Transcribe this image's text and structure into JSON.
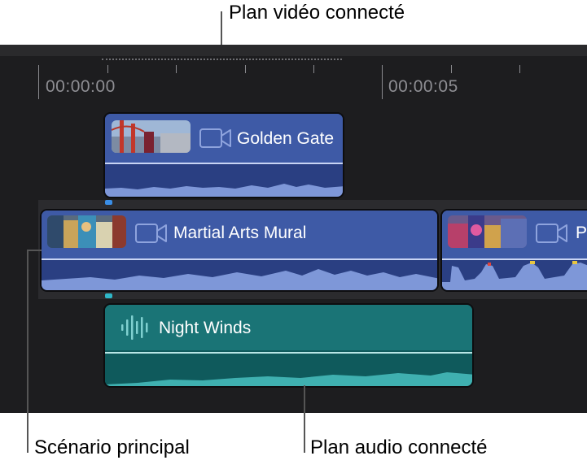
{
  "callouts": {
    "connected_video": "Plan vidéo connecté",
    "primary_storyline": "Scénario principal",
    "connected_audio": "Plan audio connecté"
  },
  "ruler": {
    "timecode_start": "00:00:00",
    "timecode_mid": "00:00:05"
  },
  "clips": {
    "connected_video": {
      "title": "Golden Gate",
      "icon": "video-camera-icon"
    },
    "primary_1": {
      "title": "Martial Arts Mural",
      "icon": "video-camera-icon"
    },
    "primary_2": {
      "title": "P",
      "icon": "video-camera-icon"
    },
    "connected_audio": {
      "title": "Night Winds",
      "icon": "audio-waveform-icon"
    }
  },
  "colors": {
    "video_clip": "#3e5aa6",
    "audio_clip": "#1a7476",
    "timeline_bg": "#1d1d1f",
    "marker": "#3a8ee6"
  }
}
